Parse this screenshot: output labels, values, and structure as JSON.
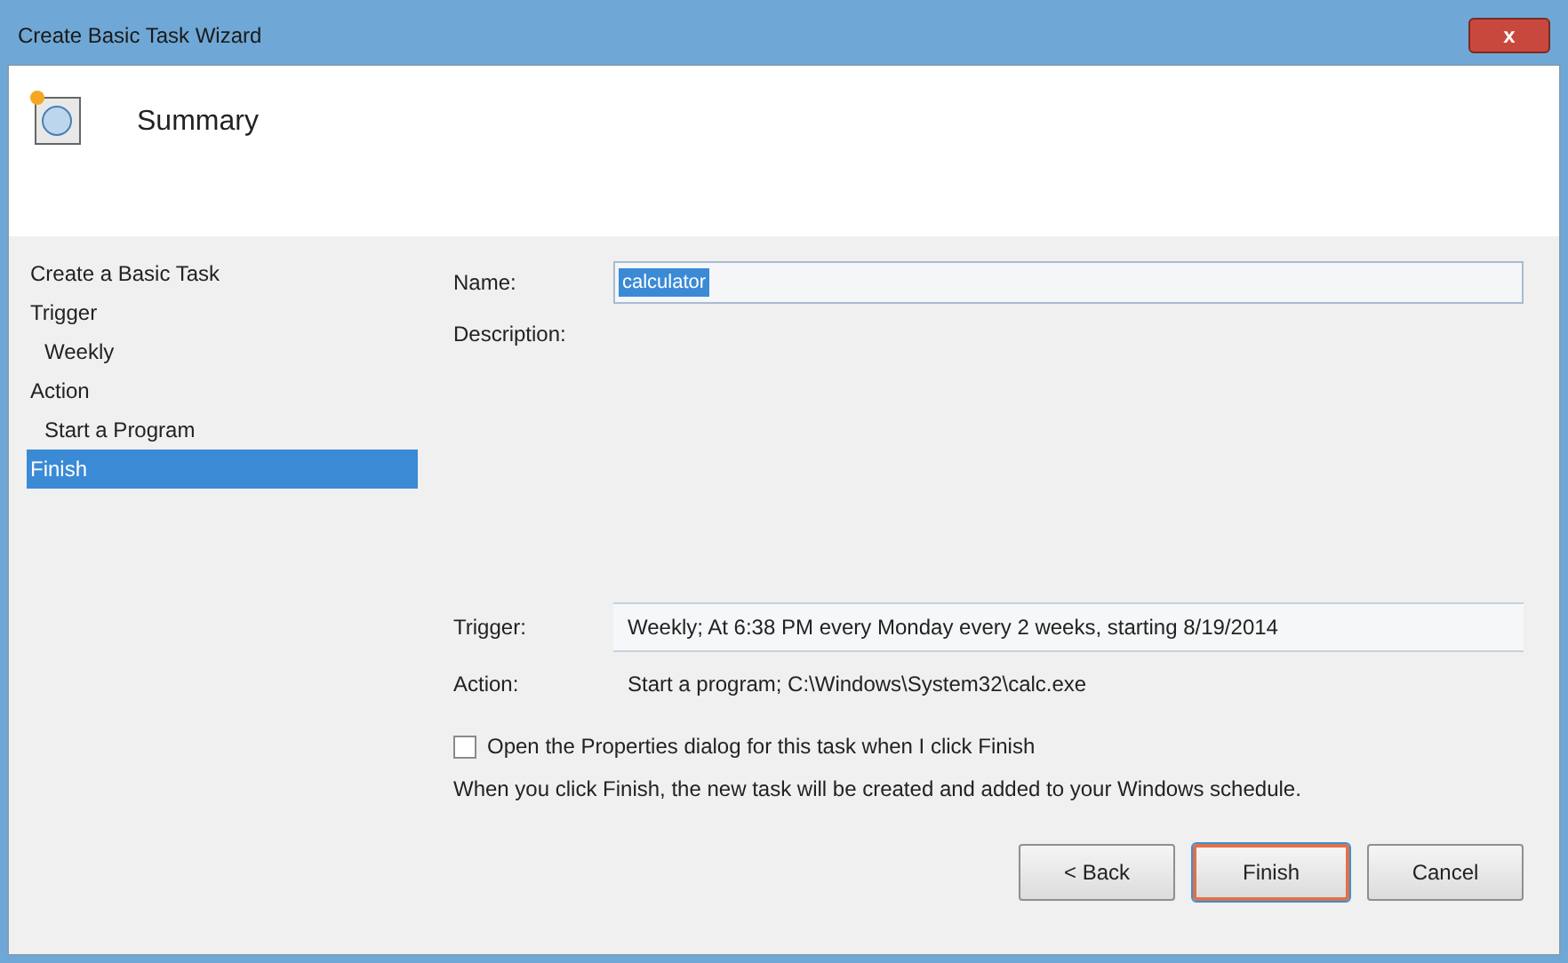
{
  "window": {
    "title": "Create Basic Task Wizard",
    "close": "x"
  },
  "header": {
    "title": "Summary"
  },
  "sidebar": {
    "items": [
      {
        "label": "Create a Basic Task",
        "selected": false
      },
      {
        "label": "Trigger",
        "selected": false,
        "children": [
          {
            "label": "Weekly",
            "selected": false
          }
        ]
      },
      {
        "label": "Action",
        "selected": false,
        "children": [
          {
            "label": "Start a Program",
            "selected": false
          }
        ]
      },
      {
        "label": "Finish",
        "selected": true
      }
    ]
  },
  "name_field": {
    "label": "Name:",
    "value": "calculator"
  },
  "description_field": {
    "label": "Description:"
  },
  "trigger": {
    "label": "Trigger:",
    "value": "Weekly; At 6:38 PM every Monday every 2 weeks, starting 8/19/2014"
  },
  "action": {
    "label": "Action:",
    "value": "Start a program; C:\\Windows\\System32\\calc.exe"
  },
  "open_properties": {
    "label": "Open the Properties dialog for this task when I click Finish",
    "checked": false
  },
  "note": "When you click Finish, the new task will be created and added to your Windows schedule.",
  "buttons": [
    {
      "label": "< Back",
      "highlighted": false
    },
    {
      "label": "Finish",
      "highlighted": true
    },
    {
      "label": "Cancel",
      "highlighted": false
    }
  ]
}
